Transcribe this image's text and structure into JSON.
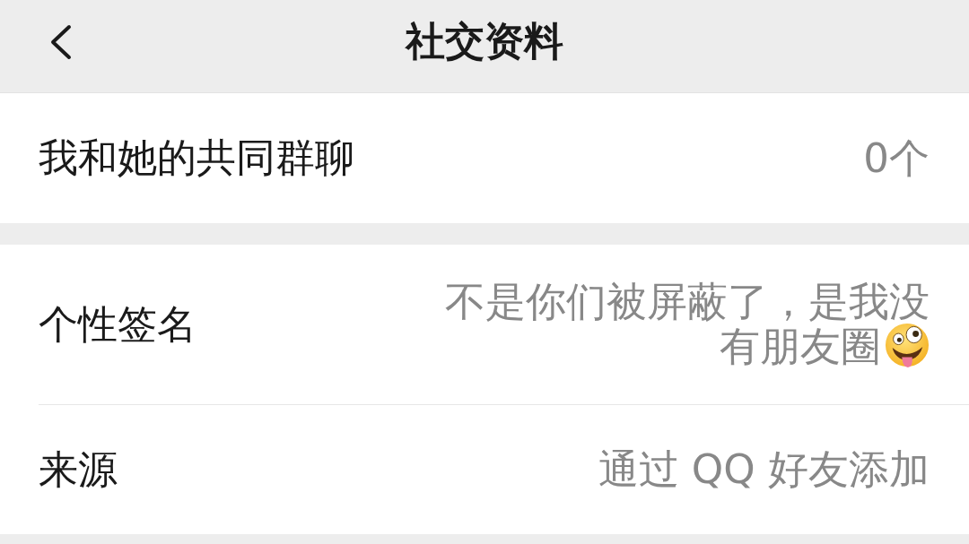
{
  "nav_bar": {
    "title": "社交资料"
  },
  "sections": [
    {
      "rows": [
        {
          "label": "我和她的共同群聊",
          "value": "0个",
          "has_emoji": false
        }
      ]
    },
    {
      "rows": [
        {
          "label": "个性签名",
          "value": "不是你们被屏蔽了，是我没有朋友圈",
          "has_emoji": true
        },
        {
          "label": "来源",
          "value": "通过 QQ 好友添加",
          "has_emoji": false
        }
      ]
    }
  ]
}
